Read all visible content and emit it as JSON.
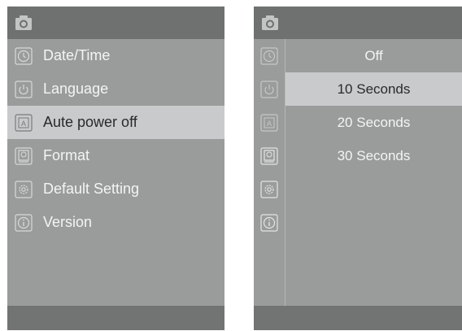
{
  "left_screen": {
    "header_icon": "camera-icon",
    "menu": [
      {
        "label": "Date/Time",
        "icon": "clock-icon",
        "selected": false
      },
      {
        "label": "Language",
        "icon": "power-icon",
        "selected": false
      },
      {
        "label": "Aute power off",
        "icon": "auto-a-icon",
        "selected": true
      },
      {
        "label": "Format",
        "icon": "format-icon",
        "selected": false
      },
      {
        "label": "Default Setting",
        "icon": "gear-icon",
        "selected": false
      },
      {
        "label": "Version",
        "icon": "info-icon",
        "selected": false
      }
    ]
  },
  "right_screen": {
    "header_icon": "camera-icon",
    "options": [
      {
        "label": "Off",
        "selected": false
      },
      {
        "label": "10 Seconds",
        "selected": true
      },
      {
        "label": "20 Seconds",
        "selected": false
      },
      {
        "label": "30 Seconds",
        "selected": false
      }
    ]
  },
  "colors": {
    "screen_bg": "#9a9b9b",
    "topbar_bg": "#6f7070",
    "selected_bg": "#c9cacb"
  }
}
